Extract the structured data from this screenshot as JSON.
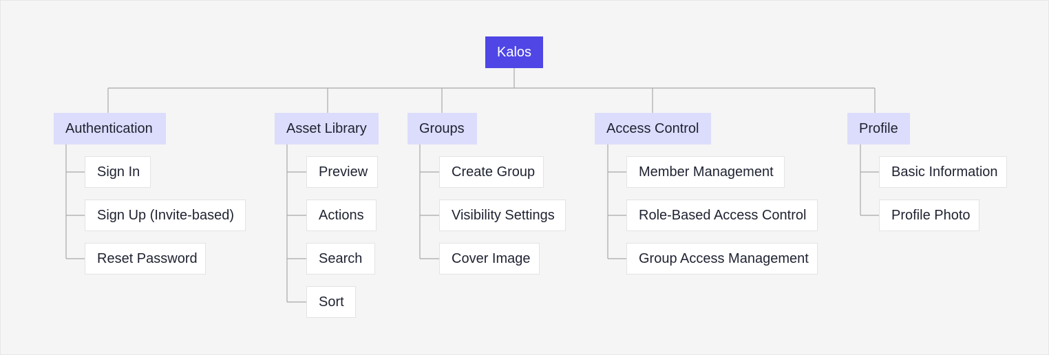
{
  "root": {
    "label": "Kalos"
  },
  "colors": {
    "background": "#f5f5f5",
    "root_fill": "#4f46e5",
    "category_fill": "#dcdcfc",
    "leaf_fill": "#ffffff",
    "connector": "#a8a8a8",
    "text": "#1e2230"
  },
  "categories": [
    {
      "label": "Authentication",
      "children": [
        "Sign In",
        "Sign Up (Invite-based)",
        "Reset Password"
      ]
    },
    {
      "label": "Asset Library",
      "children": [
        "Preview",
        "Actions",
        "Search",
        "Sort"
      ]
    },
    {
      "label": "Groups",
      "children": [
        "Create Group",
        "Visibility Settings",
        "Cover Image"
      ]
    },
    {
      "label": "Access Control",
      "children": [
        "Member Management",
        "Role-Based Access Control",
        "Group Access Management"
      ]
    },
    {
      "label": "Profile",
      "children": [
        "Basic Information",
        "Profile Photo"
      ]
    }
  ]
}
